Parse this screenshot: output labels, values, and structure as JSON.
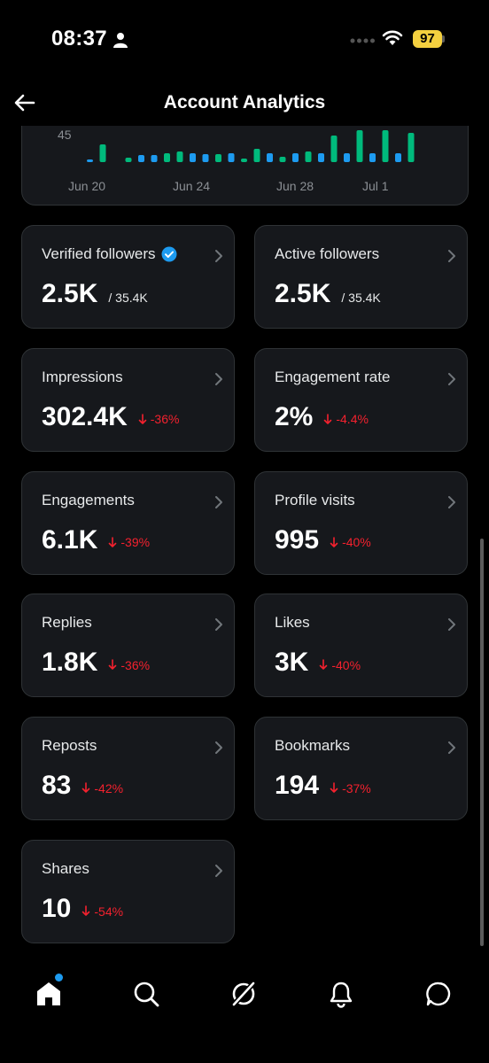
{
  "status_bar": {
    "time": "08:37",
    "battery": "97"
  },
  "header": {
    "title": "Account Analytics"
  },
  "chart_data": {
    "type": "bar",
    "y_tick": "45",
    "x_ticks": [
      "Jun 20",
      "Jun 24",
      "Jun 28",
      "Jul 1"
    ],
    "series": [
      {
        "color": "#1d9bf0",
        "values": [
          3,
          0,
          0,
          0,
          8,
          8,
          0,
          0,
          10,
          9,
          0,
          10,
          0,
          0,
          10,
          0,
          10,
          0,
          10,
          0,
          10,
          0,
          10,
          0,
          10,
          0
        ]
      },
      {
        "color": "#00ba7c",
        "values": [
          0,
          20,
          0,
          5,
          0,
          0,
          10,
          12,
          0,
          0,
          9,
          0,
          4,
          15,
          0,
          6,
          0,
          12,
          0,
          30,
          0,
          36,
          0,
          36,
          0,
          33
        ]
      }
    ],
    "colors": {
      "verified_followers": "#1d9bf0",
      "active_followers": "#00ba7c"
    }
  },
  "metrics": [
    {
      "label": "Verified followers",
      "value": "2.5K",
      "sub": "/ 35.4K",
      "verified": true
    },
    {
      "label": "Active followers",
      "value": "2.5K",
      "sub": "/ 35.4K"
    },
    {
      "label": "Impressions",
      "value": "302.4K",
      "delta": "-36%"
    },
    {
      "label": "Engagement rate",
      "value": "2%",
      "delta": "-4.4%"
    },
    {
      "label": "Engagements",
      "value": "6.1K",
      "delta": "-39%"
    },
    {
      "label": "Profile visits",
      "value": "995",
      "delta": "-40%"
    },
    {
      "label": "Replies",
      "value": "1.8K",
      "delta": "-36%"
    },
    {
      "label": "Likes",
      "value": "3K",
      "delta": "-40%"
    },
    {
      "label": "Reposts",
      "value": "83",
      "delta": "-42%"
    },
    {
      "label": "Bookmarks",
      "value": "194",
      "delta": "-37%"
    },
    {
      "label": "Shares",
      "value": "10",
      "delta": "-54%"
    }
  ],
  "nav": {
    "items": [
      "home-icon",
      "search-icon",
      "grok-icon",
      "bell-icon",
      "messages-icon"
    ]
  },
  "colors": {
    "accent": "#1d9bf0",
    "negative": "#f4212e",
    "positive": "#00ba7c",
    "card": "#16181c"
  }
}
